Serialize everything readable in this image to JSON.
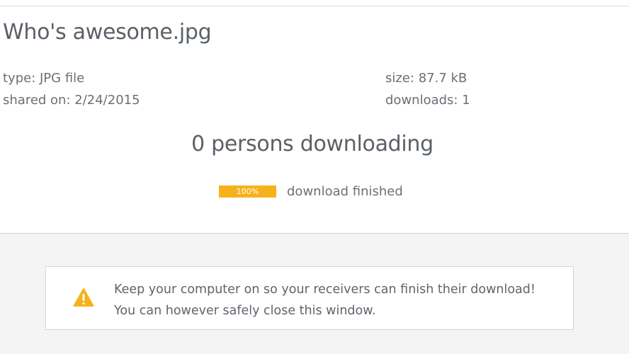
{
  "file": {
    "name": "Who's awesome.jpg",
    "type": "type: JPG file",
    "shared_on": "shared on: 2/24/2015",
    "size": "size: 87.7 kB",
    "downloads": "downloads: 1"
  },
  "status": {
    "persons_downloading": "0 persons downloading",
    "progress_percent": 100,
    "progress_label": "100%",
    "progress_text": "download finished"
  },
  "notice": {
    "icon": "warning-icon",
    "line1": "Keep your computer on so your receivers can finish their download!",
    "line2": "You can however safely close this window."
  },
  "colors": {
    "accent": "#f7b21b",
    "text": "#5a6067",
    "background_bottom": "#f4f4f4"
  }
}
